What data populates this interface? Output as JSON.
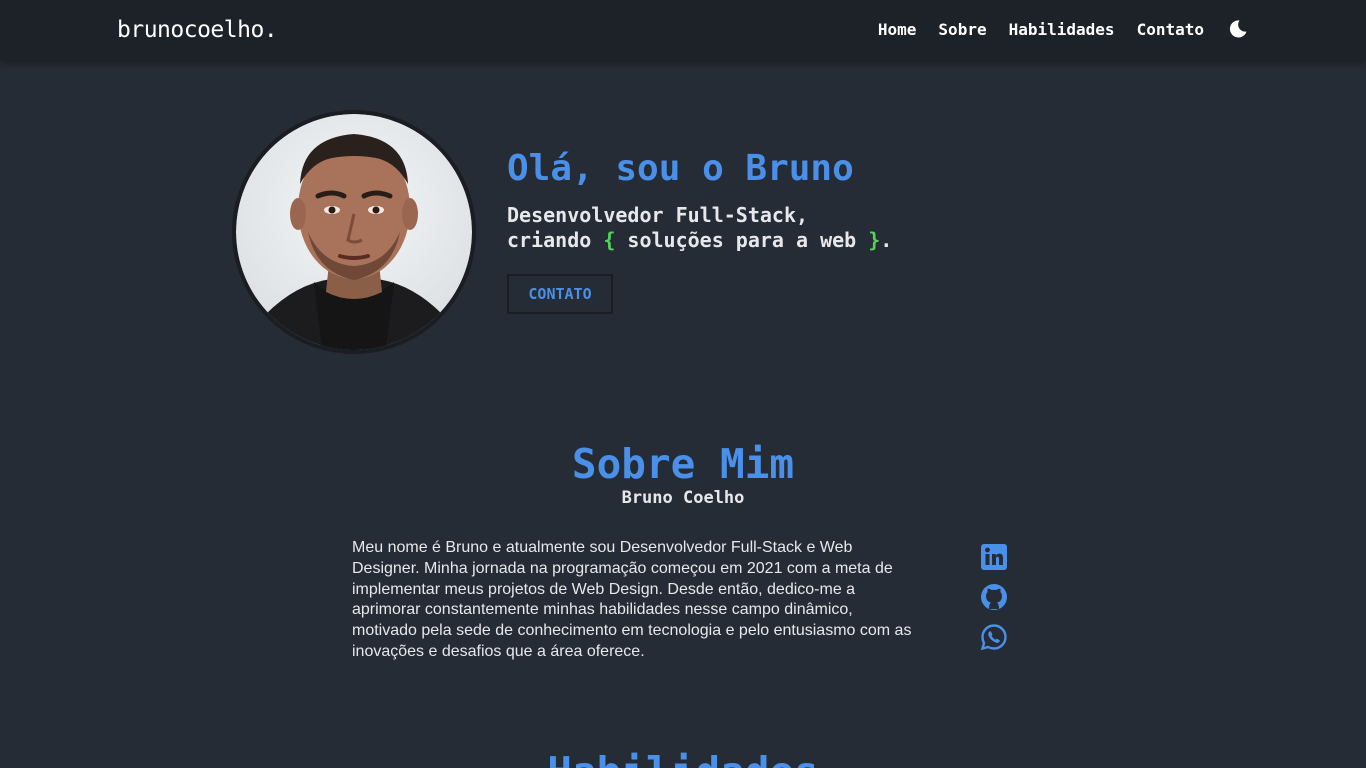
{
  "nav": {
    "brand": "brunocoelho",
    "brand_dot": ".",
    "links": [
      "Home",
      "Sobre",
      "Habilidades",
      "Contato"
    ],
    "theme_icon": "moon-icon"
  },
  "hero": {
    "title": "Olá, sou o Bruno",
    "subtitle_line1": "Desenvolvedor Full-Stack,",
    "subtitle_line2_pre": "criando ",
    "brace_open": "{",
    "subtitle_mid": " soluções para a web ",
    "brace_close": "}",
    "subtitle_end": ".",
    "button": "CONTATO"
  },
  "about": {
    "title": "Sobre Mim",
    "name": "Bruno Coelho",
    "text": "Meu nome é Bruno e atualmente sou Desenvolvedor Full-Stack e Web Designer. Minha jornada na programação começou em 2021 com a meta de implementar meus projetos de Web Design. Desde então, dedico-me a aprimorar constantemente minhas habilidades nesse campo dinâmico, motivado pela sede de conhecimento em tecnologia e pelo entusiasmo com as inovações e desafios que a área oferece.",
    "social_icons": [
      "linkedin-icon",
      "github-icon",
      "whatsapp-icon"
    ]
  },
  "skills": {
    "title": "Habilidades"
  },
  "colors": {
    "accent": "#4a90e8",
    "brace": "#4fd45c",
    "background": "#262c35",
    "navbar": "#1d2128"
  }
}
